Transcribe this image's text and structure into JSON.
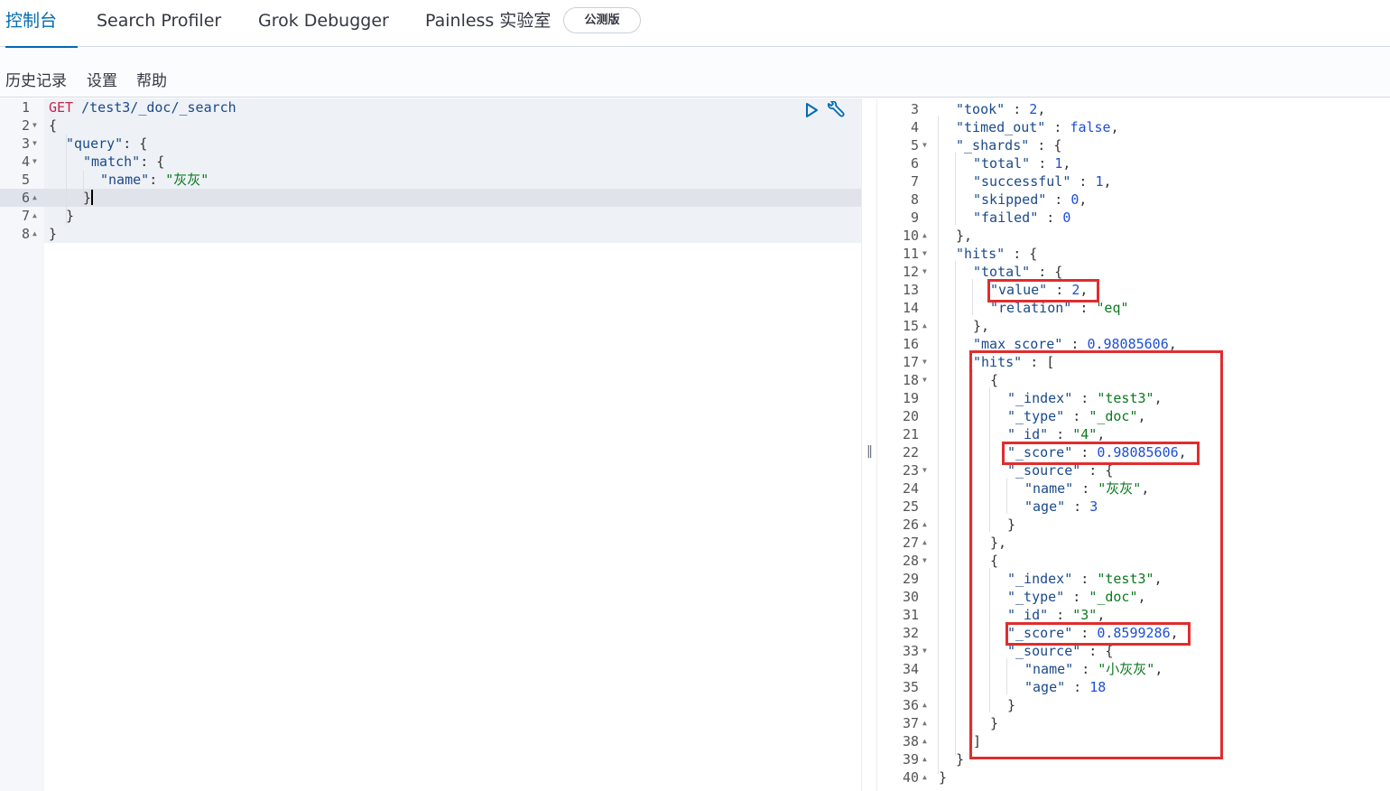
{
  "tabs": [
    {
      "label": "控制台",
      "active": true
    },
    {
      "label": "Search Profiler",
      "active": false
    },
    {
      "label": "Grok Debugger",
      "active": false
    },
    {
      "label": "Painless 实验室",
      "active": false
    }
  ],
  "beta_badge": "公测版",
  "menu": {
    "history": "历史记录",
    "settings": "设置",
    "help": "帮助"
  },
  "request": {
    "method": "GET",
    "path": "/test3/_doc/_search",
    "lines": [
      {
        "n": "1",
        "fold": ""
      },
      {
        "n": "2",
        "fold": "down"
      },
      {
        "n": "3",
        "fold": "down"
      },
      {
        "n": "4",
        "fold": "down"
      },
      {
        "n": "5",
        "fold": ""
      },
      {
        "n": "6",
        "fold": "up"
      },
      {
        "n": "7",
        "fold": "up"
      },
      {
        "n": "8",
        "fold": "up"
      }
    ],
    "brace_open": "{",
    "query_key": "\"query\"",
    "match_key": "\"match\"",
    "name_key": "\"name\"",
    "name_value": "\"灰灰\"",
    "brace_close": "}"
  },
  "response": {
    "line_numbers": [
      "3",
      "4",
      "5",
      "6",
      "7",
      "8",
      "9",
      "10",
      "11",
      "12",
      "13",
      "14",
      "15",
      "16",
      "17",
      "18",
      "19",
      "20",
      "21",
      "22",
      "23",
      "24",
      "25",
      "26",
      "27",
      "28",
      "29",
      "30",
      "31",
      "32",
      "33",
      "34",
      "35",
      "36",
      "37",
      "38",
      "39",
      "40"
    ],
    "folds": [
      "",
      "",
      "down",
      "",
      "",
      "",
      "",
      "up",
      "down",
      "down",
      "",
      "",
      "up",
      "",
      "down",
      "down",
      "",
      "",
      "",
      "",
      "down",
      "",
      "",
      "up",
      "up",
      "down",
      "",
      "",
      "",
      "",
      "down",
      "",
      "",
      "up",
      "up",
      "up",
      "up",
      "up"
    ],
    "took_key": "\"took\"",
    "took_val": "2",
    "timed_out_key": "\"timed_out\"",
    "timed_out_val": "false",
    "shards_key": "\"_shards\"",
    "total_key": "\"total\"",
    "total_val": "1",
    "successful_key": "\"successful\"",
    "successful_val": "1",
    "skipped_key": "\"skipped\"",
    "skipped_val": "0",
    "failed_key": "\"failed\"",
    "failed_val": "0",
    "hits_key": "\"hits\"",
    "value_key": "\"value\"",
    "value_val": "2",
    "relation_key": "\"relation\"",
    "relation_val": "\"eq\"",
    "max_score_key": "\"max_score\"",
    "max_score_val": "0.98085606",
    "index_key": "\"_index\"",
    "type_key": "\"_type\"",
    "id_key": "\"_id\"",
    "score_key": "\"_score\"",
    "source_key": "\"_source\"",
    "name_key": "\"name\"",
    "age_key": "\"age\"",
    "hit1": {
      "index": "\"test3\"",
      "type": "\"_doc\"",
      "id": "\"4\"",
      "score": "0.98085606",
      "name": "\"灰灰\"",
      "age": "3"
    },
    "hit2": {
      "index": "\"test3\"",
      "type": "\"_doc\"",
      "id": "\"3\"",
      "score": "0.8599286",
      "name": "\"小灰灰\"",
      "age": "18"
    }
  },
  "colors": {
    "accent": "#006bb4",
    "highlight": "#e02d2d"
  }
}
